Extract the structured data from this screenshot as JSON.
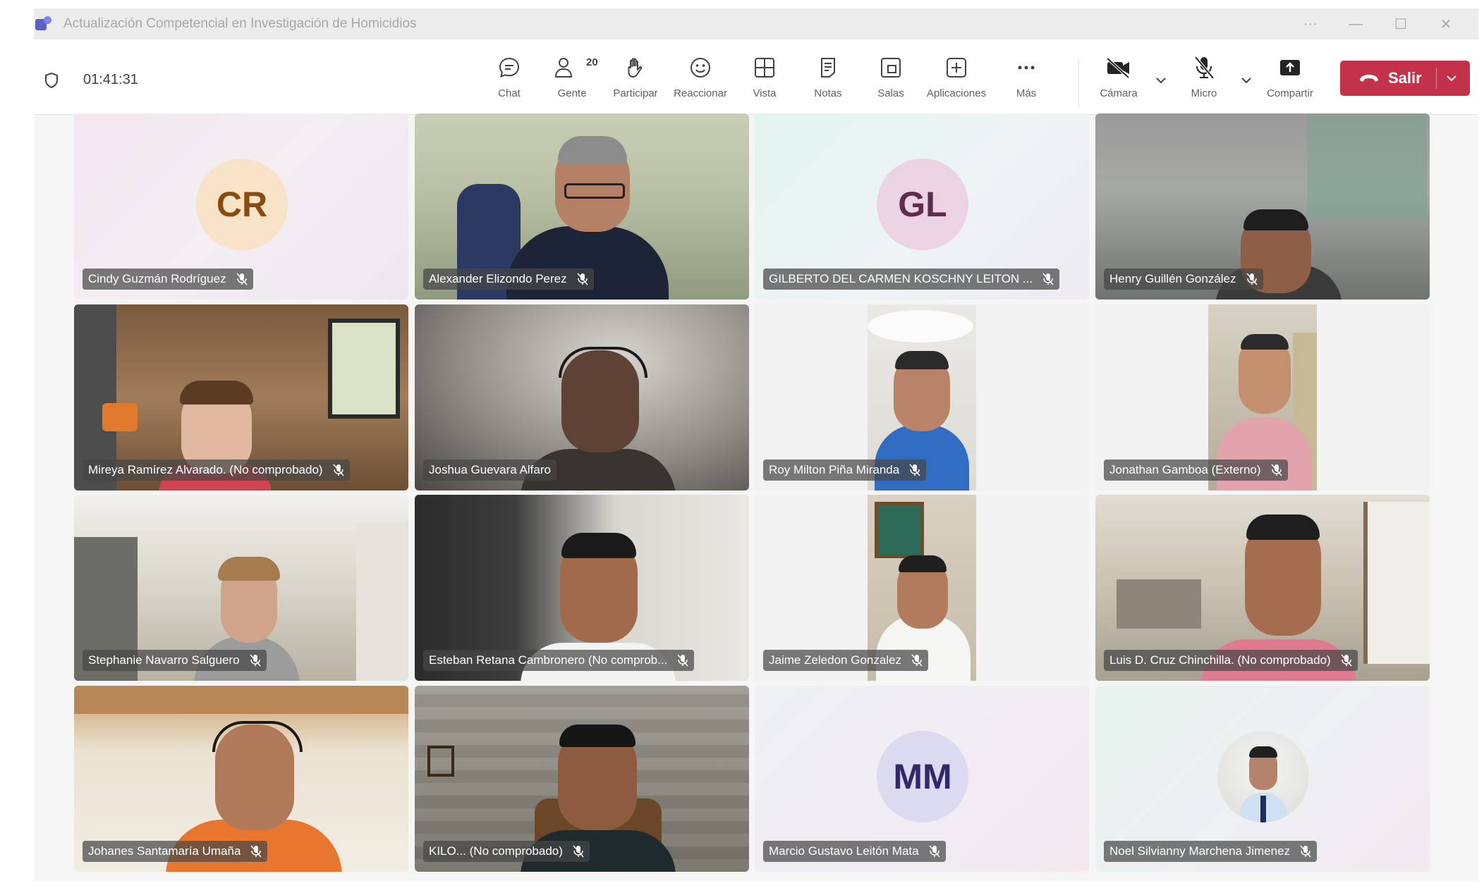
{
  "window": {
    "title": "Actualización Competencial en Investigación de Homicidios",
    "controls": [
      "···",
      "—",
      "☐",
      "✕"
    ]
  },
  "meeting": {
    "timer": "01:41:31"
  },
  "toolbar": {
    "items": [
      {
        "label": "Chat",
        "icon": "chat-icon"
      },
      {
        "label": "Gente",
        "icon": "people-icon",
        "badge": "20"
      },
      {
        "label": "Participar",
        "icon": "raise-hand-icon"
      },
      {
        "label": "Reaccionar",
        "icon": "react-icon"
      },
      {
        "label": "Vista",
        "icon": "view-grid-icon"
      },
      {
        "label": "Notas",
        "icon": "notes-icon"
      },
      {
        "label": "Salas",
        "icon": "rooms-icon"
      },
      {
        "label": "Aplicaciones",
        "icon": "apps-add-icon"
      },
      {
        "label": "Más",
        "icon": "more-icon"
      },
      {
        "label": "Cámara",
        "icon": "camera-off-icon"
      },
      {
        "label": "Micro",
        "icon": "mic-off-icon"
      },
      {
        "label": "Compartir",
        "icon": "share-icon"
      }
    ],
    "leave_label": "Salir",
    "leave_color": "#c4314b"
  },
  "participants": [
    {
      "name": "Cindy Guzmán Rodríguez",
      "initials": "CR",
      "avatar_bg": "#f6e3c8",
      "avatar_fg": "#8a4b0f"
    },
    {
      "name": "Alexander Elizondo Perez"
    },
    {
      "name": "GILBERTO DEL CARMEN KOSCHNY LEITON ...",
      "initials": "GL",
      "avatar_bg": "#ecd3e3",
      "avatar_fg": "#5c2e4b"
    },
    {
      "name": "Henry Guillén González"
    },
    {
      "name": "Mireya Ramírez Alvarado. (No comprobado)"
    },
    {
      "name": "Joshua Guevara Alfaro"
    },
    {
      "name": "Roy Milton Piña Miranda"
    },
    {
      "name": "Jonathan Gamboa (Externo)"
    },
    {
      "name": "Stephanie Navarro Salguero"
    },
    {
      "name": "Esteban Retana Cambronero (No comprob..."
    },
    {
      "name": "Jaime Zeledon Gonzalez"
    },
    {
      "name": "Luis D. Cruz Chinchilla. (No comprobado)"
    },
    {
      "name": "Johanes Santamaría Umaña"
    },
    {
      "name": "KILO... (No comprobado)"
    },
    {
      "name": "Marcio Gustavo Leitón Mata",
      "initials": "MM",
      "avatar_bg": "#dcdaf0",
      "avatar_fg": "#2f2a6b"
    },
    {
      "name": "Noel Silvianny Marchena Jimenez"
    }
  ]
}
